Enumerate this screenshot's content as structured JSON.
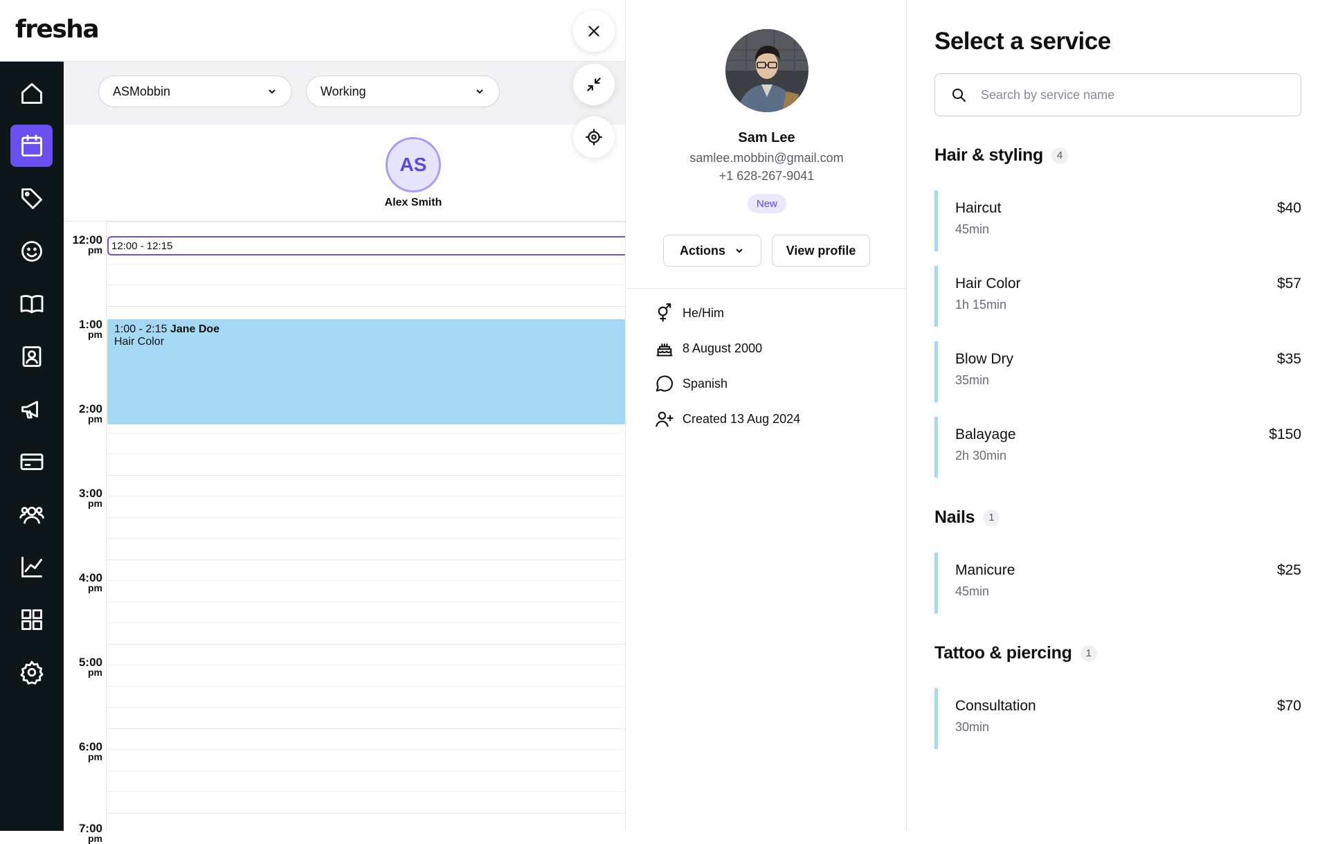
{
  "app": {
    "logo": "fresha"
  },
  "sidebar": {
    "items": [
      {
        "name": "home",
        "icon": "home-icon"
      },
      {
        "name": "calendar",
        "icon": "calendar-icon",
        "active": true
      },
      {
        "name": "sales",
        "icon": "tag-icon"
      },
      {
        "name": "clients",
        "icon": "smiley-icon"
      },
      {
        "name": "catalog",
        "icon": "book-icon"
      },
      {
        "name": "team",
        "icon": "contact-card-icon"
      },
      {
        "name": "marketing",
        "icon": "megaphone-icon"
      },
      {
        "name": "payments",
        "icon": "card-icon"
      },
      {
        "name": "team-members",
        "icon": "people-icon"
      },
      {
        "name": "reports",
        "icon": "chart-icon"
      },
      {
        "name": "addons",
        "icon": "grid-icon"
      },
      {
        "name": "settings",
        "icon": "gear-icon"
      }
    ],
    "accent": "#6950f3"
  },
  "calendar": {
    "location_dropdown": "ASMobbin",
    "status_dropdown": "Working",
    "staff": {
      "initials": "AS",
      "name": "Alex Smith"
    },
    "hours": [
      {
        "h": "12:00",
        "m": "pm"
      },
      {
        "h": "1:00",
        "m": "pm"
      },
      {
        "h": "2:00",
        "m": "pm"
      },
      {
        "h": "3:00",
        "m": "pm"
      },
      {
        "h": "4:00",
        "m": "pm"
      },
      {
        "h": "5:00",
        "m": "pm"
      },
      {
        "h": "6:00",
        "m": "pm"
      },
      {
        "h": "7:00",
        "m": "pm"
      }
    ],
    "selected_slot": "12:00 - 12:15",
    "appointment": {
      "time": "1:00 - 2:15",
      "client": "Jane Doe",
      "service": "Hair Color",
      "color": "#a5d8f3"
    }
  },
  "client": {
    "name": "Sam Lee",
    "email": "samlee.mobbin@gmail.com",
    "phone": "+1 628-267-9041",
    "badge": "New",
    "actions_label": "Actions",
    "view_profile_label": "View profile",
    "pronouns": "He/Him",
    "birthday": "8 August 2000",
    "language": "Spanish",
    "created": "Created 13 Aug 2024"
  },
  "services": {
    "title": "Select a service",
    "search_placeholder": "Search by service name",
    "categories": [
      {
        "name": "Hair & styling",
        "count": "4",
        "items": [
          {
            "name": "Haircut",
            "duration": "45min",
            "price": "$40"
          },
          {
            "name": "Hair Color",
            "duration": "1h 15min",
            "price": "$57"
          },
          {
            "name": "Blow Dry",
            "duration": "35min",
            "price": "$35"
          },
          {
            "name": "Balayage",
            "duration": "2h 30min",
            "price": "$150"
          }
        ]
      },
      {
        "name": "Nails",
        "count": "1",
        "items": [
          {
            "name": "Manicure",
            "duration": "45min",
            "price": "$25"
          }
        ]
      },
      {
        "name": "Tattoo & piercing",
        "count": "1",
        "items": [
          {
            "name": "Consultation",
            "duration": "30min",
            "price": "$70"
          }
        ]
      }
    ]
  }
}
